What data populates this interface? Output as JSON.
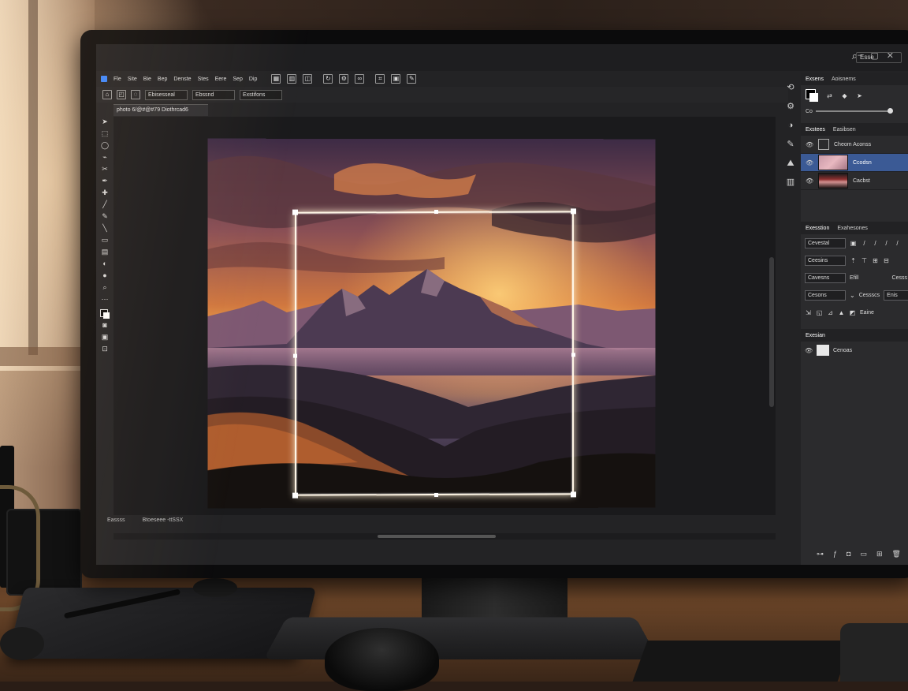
{
  "app": {
    "doc_tab_title": "photo 6/@#@#79 Diothrcad6",
    "accent_color": "#3b5a95"
  },
  "system_bar": {
    "search_placeholder": "Esse",
    "icons": [
      "minimize-icon",
      "maximize-icon",
      "close-icon",
      "search-icon"
    ]
  },
  "menubar": {
    "items": [
      "Fle",
      "Site",
      "Bie",
      "Bep",
      "Denste",
      "Stes",
      "Eere",
      "Sep",
      "Dip"
    ]
  },
  "options_bar": {
    "select_1": "Ebisesseal",
    "select_2": "Ebssnd",
    "select_3": "Exstifons"
  },
  "status_bar": {
    "zoom": "Eassss",
    "doc_info": "Btoeseee -ttSSX"
  },
  "panels": {
    "color": {
      "tabs": [
        "Exsens",
        "Aoisnems"
      ],
      "slider_label": "Co",
      "slider_value": 0.95
    },
    "layers": {
      "tabs": [
        "Exstees",
        "Easibsen"
      ],
      "items": [
        {
          "name": "Cheom Aconss",
          "kind": "adjustment",
          "visible": true,
          "selected": false
        },
        {
          "name": "Ccodsn",
          "kind": "image-pink",
          "visible": true,
          "selected": true
        },
        {
          "name": "Cacbst",
          "kind": "image-red",
          "visible": true,
          "selected": false
        }
      ]
    },
    "properties": {
      "tabs": [
        "Exesstion",
        "Exahesones"
      ],
      "row1": {
        "select": "Cevestal"
      },
      "row2": {
        "select": "Ceesins"
      },
      "row3": {
        "select": "Cavesns",
        "label": "Efill",
        "right": "Cesss"
      },
      "row4": {
        "select": "Cesons",
        "label": "Cessscs",
        "right": "Enis"
      },
      "row5": {
        "label": "Eaine"
      }
    },
    "mini_panel": {
      "tab": "Exesian",
      "item_label": "Cenoas"
    }
  },
  "canvas": {
    "crop_active": true
  }
}
